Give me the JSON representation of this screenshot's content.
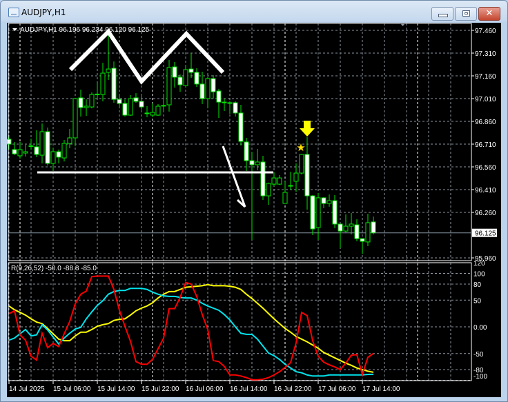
{
  "window": {
    "title": "AUDJPY,H1"
  },
  "legend": {
    "main": "AUDJPY,H1  96.196 96.234 96.120 96.125",
    "indicator": "R(9,26,52) -50.0 -88.8 -85.0"
  },
  "current_price": {
    "label": "96.125",
    "value": 96.125
  },
  "price_ticks": [
    {
      "label": "97.460",
      "value": 97.46
    },
    {
      "label": "97.310",
      "value": 97.31
    },
    {
      "label": "97.160",
      "value": 97.16
    },
    {
      "label": "97.010",
      "value": 97.01
    },
    {
      "label": "96.860",
      "value": 96.86
    },
    {
      "label": "96.710",
      "value": 96.71
    },
    {
      "label": "96.560",
      "value": 96.56
    },
    {
      "label": "96.410",
      "value": 96.41
    },
    {
      "label": "96.260",
      "value": 96.26
    },
    {
      "label": "95.960",
      "value": 95.96
    }
  ],
  "indicator_ticks": [
    {
      "label": "120",
      "value": 120
    },
    {
      "label": "100",
      "value": 100
    },
    {
      "label": "80",
      "value": 80
    },
    {
      "label": "50",
      "value": 50
    },
    {
      "label": "0.00",
      "value": 0
    },
    {
      "label": "-50",
      "value": -50
    },
    {
      "label": "-80",
      "value": -80
    },
    {
      "label": "-100",
      "value": -100
    }
  ],
  "time_labels": [
    {
      "label": "14 Jul 2025",
      "bar": 0
    },
    {
      "label": "15 Jul 06:00",
      "bar": 8
    },
    {
      "label": "15 Jul 14:00",
      "bar": 16
    },
    {
      "label": "15 Jul 22:00",
      "bar": 24
    },
    {
      "label": "16 Jul 06:00",
      "bar": 32
    },
    {
      "label": "16 Jul 14:00",
      "bar": 40
    },
    {
      "label": "16 Jul 22:00",
      "bar": 48
    },
    {
      "label": "17 Jul 06:00",
      "bar": 56
    },
    {
      "label": "17 Jul 14:00",
      "bar": 64
    }
  ],
  "colors": {
    "bull_outline": "#00e600",
    "bear_fill": "#ffffff",
    "red": "#ff0000",
    "cyan": "#00e5ee",
    "yellow": "#ffff00",
    "grid": "#8c96a0",
    "axis_text": "#ffffff"
  },
  "chart_data": {
    "type": "candlestick",
    "ohlc": [
      [
        96.742,
        96.76,
        96.674,
        96.71
      ],
      [
        96.674,
        96.724,
        96.637,
        96.646
      ],
      [
        96.633,
        96.724,
        96.615,
        96.674
      ],
      [
        96.651,
        96.706,
        96.628,
        96.66
      ],
      [
        96.696,
        96.746,
        96.674,
        96.699
      ],
      [
        96.692,
        96.801,
        96.624,
        96.642
      ],
      [
        96.637,
        96.846,
        96.583,
        96.792
      ],
      [
        96.792,
        96.819,
        96.569,
        96.583
      ],
      [
        96.583,
        96.687,
        96.533,
        96.66
      ],
      [
        96.66,
        96.674,
        96.583,
        96.624
      ],
      [
        96.619,
        96.737,
        96.596,
        96.715
      ],
      [
        96.715,
        96.81,
        96.683,
        96.751
      ],
      [
        96.751,
        97.015,
        96.696,
        97.01
      ],
      [
        97.015,
        97.069,
        96.892,
        96.951
      ],
      [
        96.951,
        97.005,
        96.896,
        96.96
      ],
      [
        96.955,
        97.051,
        96.946,
        97.037
      ],
      [
        97.037,
        97.115,
        97.01,
        97.04
      ],
      [
        97.037,
        97.246,
        96.992,
        97.178
      ],
      [
        97.183,
        97.455,
        97.133,
        97.205
      ],
      [
        97.21,
        97.255,
        96.983,
        97.005
      ],
      [
        97.005,
        97.042,
        96.946,
        96.978
      ],
      [
        96.978,
        97.005,
        96.892,
        96.901
      ],
      [
        96.901,
        97.033,
        96.896,
        97.01
      ],
      [
        97.015,
        97.046,
        96.983,
        96.992
      ],
      [
        96.992,
        97.042,
        96.937,
        96.955
      ],
      [
        96.915,
        96.96,
        96.887,
        96.913
      ],
      [
        96.901,
        96.978,
        96.887,
        96.919
      ],
      [
        96.901,
        96.974,
        96.896,
        96.96
      ],
      [
        96.965,
        97.037,
        96.919,
        96.963
      ],
      [
        96.969,
        97.265,
        96.924,
        97.215
      ],
      [
        97.219,
        97.251,
        97.083,
        97.151
      ],
      [
        97.151,
        97.169,
        97.055,
        97.101
      ],
      [
        97.096,
        97.233,
        97.083,
        97.201
      ],
      [
        97.205,
        97.31,
        97.146,
        97.183
      ],
      [
        97.183,
        97.21,
        97.087,
        97.106
      ],
      [
        97.106,
        97.187,
        96.974,
        97.01
      ],
      [
        97.01,
        97.151,
        96.946,
        97.142
      ],
      [
        97.142,
        97.165,
        97.01,
        97.055
      ],
      [
        97.06,
        97.074,
        96.883,
        96.987
      ],
      [
        96.987,
        97.01,
        96.928,
        96.985
      ],
      [
        96.983,
        96.992,
        96.91,
        96.981
      ],
      [
        96.983,
        96.992,
        96.892,
        96.915
      ],
      [
        96.915,
        96.969,
        96.701,
        96.728
      ],
      [
        96.724,
        96.751,
        96.533,
        96.601
      ],
      [
        96.601,
        96.66,
        96.078,
        96.574
      ],
      [
        96.574,
        96.678,
        96.537,
        96.592
      ],
      [
        96.592,
        96.633,
        96.342,
        96.369
      ],
      [
        96.369,
        96.456,
        96.31,
        96.451
      ],
      [
        96.446,
        96.524,
        96.433,
        96.487
      ],
      [
        96.446,
        96.506,
        96.442,
        96.487
      ],
      [
        96.319,
        96.465,
        96.319,
        96.392
      ],
      [
        96.437,
        96.528,
        96.41,
        96.435
      ],
      [
        96.465,
        96.583,
        96.396,
        96.519
      ],
      [
        96.519,
        96.646,
        96.51,
        96.642
      ],
      [
        96.642,
        96.756,
        96.278,
        96.369
      ],
      [
        96.369,
        96.374,
        96.11,
        96.151
      ],
      [
        96.16,
        96.387,
        96.078,
        96.356
      ],
      [
        96.356,
        96.36,
        96.287,
        96.319
      ],
      [
        96.319,
        96.378,
        96.297,
        96.337
      ],
      [
        96.337,
        96.374,
        96.156,
        96.183
      ],
      [
        96.183,
        96.183,
        96.024,
        96.137
      ],
      [
        96.137,
        96.247,
        96.128,
        96.169
      ],
      [
        96.169,
        96.256,
        96.115,
        96.183
      ],
      [
        96.178,
        96.215,
        96.069,
        96.087
      ],
      [
        96.087,
        96.087,
        95.987,
        96.069
      ],
      [
        96.065,
        96.251,
        96.037,
        96.192
      ],
      [
        96.197,
        96.233,
        96.115,
        96.125
      ]
    ],
    "ylim": [
      95.96,
      97.46
    ],
    "indicator": {
      "name": "R(9,26,52)",
      "ylim": [
        -100,
        120
      ],
      "series": [
        {
          "name": "R9",
          "color": "#ff0000",
          "values": [
            24.5,
            30,
            -15,
            -25,
            -55,
            -62,
            -12,
            -39,
            -31,
            -37,
            -13,
            10,
            43,
            61,
            67,
            94,
            95,
            95,
            95,
            70,
            31,
            1,
            -27,
            -65,
            -70,
            -70,
            -61,
            -41,
            -21,
            34,
            34,
            55,
            83,
            80,
            57,
            23,
            -5,
            -63,
            -65,
            -74,
            -90,
            -90,
            -92,
            -95,
            -99,
            -99,
            -98,
            -95,
            -90,
            -84,
            -76,
            -67,
            -30,
            27,
            21,
            -26,
            -55,
            -66,
            -71,
            -75,
            -80,
            -68,
            -53,
            -52,
            -89,
            -57,
            -50
          ]
        },
        {
          "name": "R26",
          "color": "#00e5ee",
          "values": [
            -25,
            -21,
            -13,
            -5,
            -17,
            -15,
            4,
            -6,
            -19,
            -32,
            -21,
            -12,
            -4,
            -1,
            15,
            28,
            40,
            49,
            61,
            66,
            68,
            68,
            72,
            72,
            72,
            70,
            65,
            61,
            58,
            57,
            57,
            55,
            54,
            54,
            50,
            44,
            39,
            35,
            31,
            23,
            13,
            0,
            -12,
            -14,
            -14,
            -23,
            -36,
            -49,
            -54,
            -61,
            -70,
            -77,
            -84,
            -86,
            -90,
            -92,
            -92,
            -92,
            -90,
            -90,
            -90,
            -90,
            -90,
            -90,
            -90,
            -89,
            -88.8
          ]
        },
        {
          "name": "R52",
          "color": "#ffff00",
          "values": [
            39,
            32,
            27,
            22,
            15,
            9,
            6,
            -3,
            -13,
            -23,
            -26,
            -26,
            -17,
            -10,
            -10,
            -5,
            1,
            4,
            6,
            12,
            14,
            15,
            22,
            30,
            35,
            39,
            45,
            54,
            61,
            66,
            66,
            70,
            74,
            75,
            76,
            77,
            79,
            77,
            77,
            77,
            76,
            74,
            70,
            61,
            53,
            44,
            35,
            25,
            15,
            6,
            -3,
            -10,
            -18,
            -23,
            -28,
            -34,
            -40,
            -48,
            -53,
            -58,
            -63,
            -68,
            -72,
            -77,
            -80,
            -83,
            -85
          ]
        }
      ]
    }
  }
}
